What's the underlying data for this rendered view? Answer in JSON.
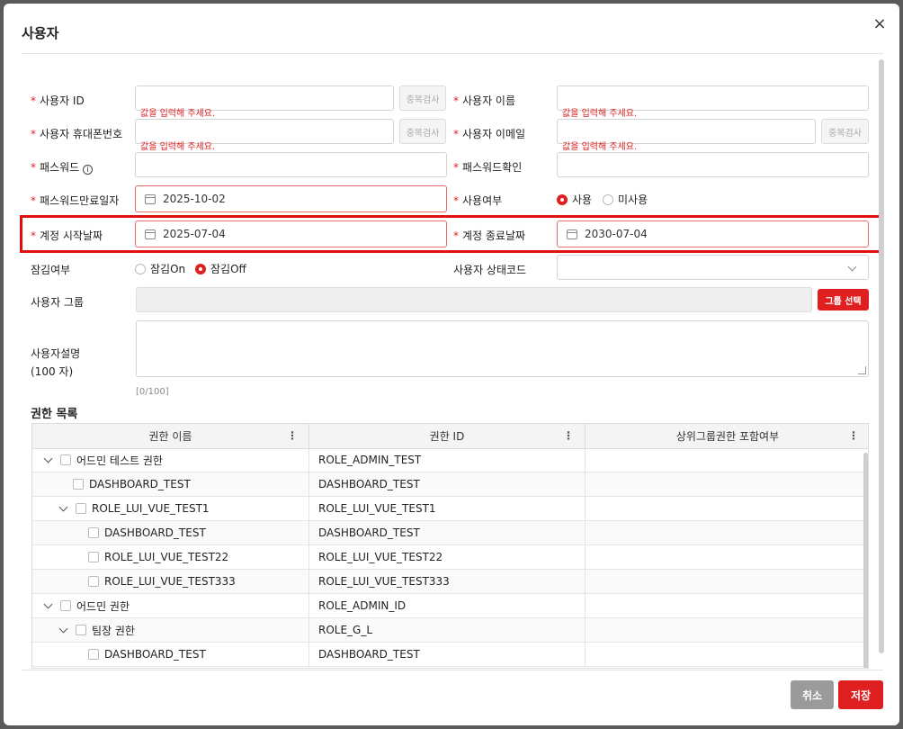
{
  "dialog": {
    "title": "사용자",
    "close_icon": "×"
  },
  "form": {
    "user_id_label": "사용자 ID",
    "user_name_label": "사용자 이름",
    "phone_label": "사용자 휴대폰번호",
    "email_label": "사용자 이메일",
    "password_label": "패스워드",
    "password_confirm_label": "패스워드확인",
    "pw_expiry_label": "패스워드만료일자",
    "pw_expiry_value": "2025-10-02",
    "use_label": "사용여부",
    "use_on": "사용",
    "use_off": "미사용",
    "start_date_label": "계정 시작날짜",
    "start_date_value": "2025-07-04",
    "end_date_label": "계정 종료날짜",
    "end_date_value": "2030-07-04",
    "lock_label": "잠김여부",
    "lock_on": "잠김On",
    "lock_off": "잠김Off",
    "status_label": "사용자 상태코드",
    "group_label": "사용자 그룹",
    "group_button": "그룹 선택",
    "desc_label_1": "사용자설명",
    "desc_label_2": "(100 자)",
    "desc_counter": "[0/100]",
    "dup_check": "중복검사",
    "error_msg": "값을 입력해 주세요.",
    "required_mark": "*",
    "info_icon": "i"
  },
  "perm": {
    "title": "권한 목록",
    "columns": [
      "권한 이름",
      "권한 ID",
      "상위그룹권한 포함여부"
    ],
    "rows": [
      {
        "name": "어드민 테스트 권한",
        "id": "ROLE_ADMIN_TEST"
      },
      {
        "name": "DASHBOARD_TEST",
        "id": "DASHBOARD_TEST"
      },
      {
        "name": "ROLE_LUI_VUE_TEST1",
        "id": "ROLE_LUI_VUE_TEST1"
      },
      {
        "name": "DASHBOARD_TEST",
        "id": "DASHBOARD_TEST"
      },
      {
        "name": "ROLE_LUI_VUE_TEST22",
        "id": "ROLE_LUI_VUE_TEST22"
      },
      {
        "name": "ROLE_LUI_VUE_TEST333",
        "id": "ROLE_LUI_VUE_TEST333"
      },
      {
        "name": "어드민 권한",
        "id": "ROLE_ADMIN_ID"
      },
      {
        "name": "팀장 권한",
        "id": "ROLE_G_L"
      },
      {
        "name": "DASHBOARD_TEST",
        "id": "DASHBOARD_TEST"
      }
    ]
  },
  "footer": {
    "cancel": "취소",
    "save": "저장"
  },
  "colors": {
    "accent": "#e02020",
    "cancel_bg": "#9a9a9a"
  }
}
